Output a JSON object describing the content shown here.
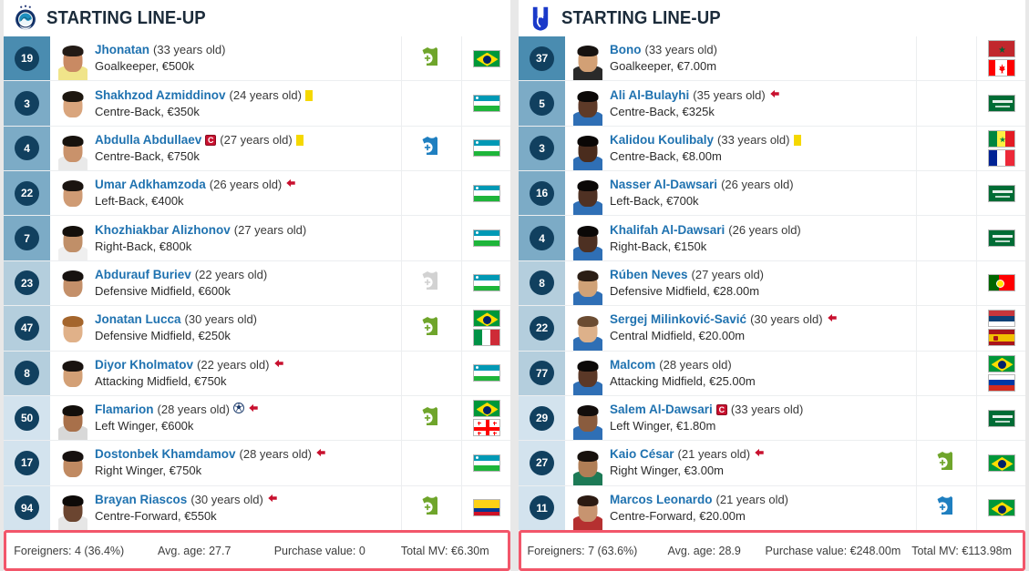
{
  "teams": [
    {
      "id": "left",
      "crest_icon": "pakhtakor-crest-icon",
      "title": "STARTING LINE-UP",
      "players": [
        {
          "number": "19",
          "name": "Jhonatan",
          "age": "(33 years old)",
          "detail": "Goalkeeper, €500k",
          "captain": false,
          "yellow": false,
          "goal": false,
          "arrow_out": false,
          "sub": "in",
          "group": "gk",
          "flags": [
            {
              "name": "brazil-flag",
              "colors": [
                "#009739",
                "#FEDD00",
                "#012169"
              ]
            }
          ],
          "skin": "#c98a63",
          "hair": "#231b16",
          "shirt": "#f0e48a"
        },
        {
          "number": "3",
          "name": "Shakhzod Azmiddinov",
          "age": "(24 years old)",
          "detail": "Centre-Back, €350k",
          "captain": false,
          "yellow": true,
          "goal": false,
          "arrow_out": false,
          "sub": "none",
          "group": "def",
          "flags": [
            {
              "name": "uzbekistan-flag",
              "colors": [
                "#0099B5",
                "#FFFFFF",
                "#1EB53A"
              ]
            }
          ],
          "skin": "#d9a57d",
          "hair": "#1d1710",
          "shirt": "#ffffff"
        },
        {
          "number": "4",
          "name": "Abdulla Abdullaev",
          "age": "(27 years old)",
          "detail": "Centre-Back, €750k",
          "captain": true,
          "yellow": true,
          "goal": false,
          "arrow_out": false,
          "sub": "out",
          "group": "def",
          "flags": [
            {
              "name": "uzbekistan-flag",
              "colors": [
                "#0099B5",
                "#FFFFFF",
                "#1EB53A"
              ]
            }
          ],
          "skin": "#c9926b",
          "hair": "#17120d",
          "shirt": "#e9e9e9"
        },
        {
          "number": "22",
          "name": "Umar Adkhamzoda",
          "age": "(26 years old)",
          "detail": "Left-Back, €400k",
          "captain": false,
          "yellow": false,
          "goal": false,
          "arrow_out": true,
          "sub": "none",
          "group": "def",
          "flags": [
            {
              "name": "uzbekistan-flag",
              "colors": [
                "#0099B5",
                "#FFFFFF",
                "#1EB53A"
              ]
            }
          ],
          "skin": "#cf9b74",
          "hair": "#1a1410",
          "shirt": "#ffffff"
        },
        {
          "number": "7",
          "name": "Khozhiakbar Alizhonov",
          "age": "(27 years old)",
          "detail": "Right-Back, €800k",
          "captain": false,
          "yellow": false,
          "goal": false,
          "arrow_out": false,
          "sub": "none",
          "group": "def",
          "flags": [
            {
              "name": "uzbekistan-flag",
              "colors": [
                "#0099B5",
                "#FFFFFF",
                "#1EB53A"
              ]
            }
          ],
          "skin": "#c08f68",
          "hair": "#130f0b",
          "shirt": "#efefef"
        },
        {
          "number": "23",
          "name": "Abdurauf Buriev",
          "age": "(22 years old)",
          "detail": "Defensive Midfield, €600k",
          "captain": false,
          "yellow": false,
          "goal": false,
          "arrow_out": false,
          "sub": "grey",
          "group": "mid",
          "flags": [
            {
              "name": "uzbekistan-flag",
              "colors": [
                "#0099B5",
                "#FFFFFF",
                "#1EB53A"
              ]
            }
          ],
          "skin": "#c4906a",
          "hair": "#171210",
          "shirt": "#ffffff"
        },
        {
          "number": "47",
          "name": "Jonatan Lucca",
          "age": "(30 years old)",
          "detail": "Defensive Midfield, €250k",
          "captain": false,
          "yellow": false,
          "goal": false,
          "arrow_out": false,
          "sub": "in",
          "group": "mid",
          "flags": [
            {
              "name": "brazil-flag",
              "colors": [
                "#009739",
                "#FEDD00",
                "#012169"
              ]
            },
            {
              "name": "italy-flag",
              "colors": [
                "#009246",
                "#FFFFFF",
                "#CE2B37"
              ]
            }
          ],
          "skin": "#e0b189",
          "hair": "#a4652c",
          "shirt": "#ffffff"
        },
        {
          "number": "8",
          "name": "Diyor Kholmatov",
          "age": "(22 years old)",
          "detail": "Attacking Midfield, €750k",
          "captain": false,
          "yellow": false,
          "goal": false,
          "arrow_out": true,
          "sub": "none",
          "group": "mid",
          "flags": [
            {
              "name": "uzbekistan-flag",
              "colors": [
                "#0099B5",
                "#FFFFFF",
                "#1EB53A"
              ]
            }
          ],
          "skin": "#d3a076",
          "hair": "#191310",
          "shirt": "#ffffff"
        },
        {
          "number": "50",
          "name": "Flamarion",
          "age": "(28 years old)",
          "detail": "Left Winger, €600k",
          "captain": false,
          "yellow": false,
          "goal": true,
          "arrow_out": true,
          "sub": "in",
          "group": "fwd",
          "flags": [
            {
              "name": "brazil-flag",
              "colors": [
                "#009739",
                "#FEDD00",
                "#012169"
              ]
            },
            {
              "name": "georgia-flag",
              "colors": [
                "#FFFFFF",
                "#FF0000",
                "#FFFFFF"
              ]
            }
          ],
          "skin": "#a8704a",
          "hair": "#120e0b",
          "shirt": "#d8d8d8"
        },
        {
          "number": "17",
          "name": "Dostonbek Khamdamov",
          "age": "(28 years old)",
          "detail": "Right Winger, €750k",
          "captain": false,
          "yellow": false,
          "goal": false,
          "arrow_out": true,
          "sub": "none",
          "group": "fwd",
          "flags": [
            {
              "name": "uzbekistan-flag",
              "colors": [
                "#0099B5",
                "#FFFFFF",
                "#1EB53A"
              ]
            }
          ],
          "skin": "#c08a62",
          "hair": "#161110",
          "shirt": "#ffffff"
        },
        {
          "number": "94",
          "name": "Brayan Riascos",
          "age": "(30 years old)",
          "detail": "Centre-Forward, €550k",
          "captain": false,
          "yellow": false,
          "goal": false,
          "arrow_out": true,
          "sub": "in",
          "group": "fwd",
          "flags": [
            {
              "name": "colombia-flag",
              "colors": [
                "#FCD116",
                "#003893",
                "#CE1126"
              ]
            }
          ],
          "skin": "#6b4530",
          "hair": "#0d0a08",
          "shirt": "#e6e6e6"
        }
      ],
      "footer": {
        "foreigners": "Foreigners: 4 (36.4%)",
        "avg_age": "Avg. age: 27.7",
        "purchase_value": "Purchase value: 0",
        "total_mv": "Total MV: €6.30m"
      }
    },
    {
      "id": "right",
      "crest_icon": "al-hilal-crest-icon",
      "title": "STARTING LINE-UP",
      "players": [
        {
          "number": "37",
          "name": "Bono",
          "age": "(33 years old)",
          "detail": "Goalkeeper, €7.00m",
          "captain": false,
          "yellow": false,
          "goal": false,
          "arrow_out": false,
          "sub": "none",
          "group": "gk",
          "flags": [
            {
              "name": "morocco-flag",
              "colors": [
                "#C1272D",
                "#006233",
                "#C1272D"
              ]
            },
            {
              "name": "canada-flag",
              "colors": [
                "#FF0000",
                "#FFFFFF",
                "#FF0000"
              ]
            }
          ],
          "skin": "#d2a075",
          "hair": "#161210",
          "shirt": "#2a2a2a"
        },
        {
          "number": "5",
          "name": "Ali Al-Bulayhi",
          "age": "(35 years old)",
          "detail": "Centre-Back, €325k",
          "captain": false,
          "yellow": false,
          "goal": false,
          "arrow_out": true,
          "sub": "none",
          "group": "def",
          "flags": [
            {
              "name": "saudi-arabia-flag",
              "colors": [
                "#006C35",
                "#FFFFFF",
                "#006C35"
              ]
            }
          ],
          "skin": "#5e3a28",
          "hair": "#0c0908",
          "shirt": "#2f6fb5"
        },
        {
          "number": "3",
          "name": "Kalidou Koulibaly",
          "age": "(33 years old)",
          "detail": "Centre-Back, €8.00m",
          "captain": false,
          "yellow": true,
          "goal": false,
          "arrow_out": false,
          "sub": "none",
          "group": "def",
          "flags": [
            {
              "name": "senegal-flag",
              "colors": [
                "#00853F",
                "#FDEF42",
                "#E31B23"
              ]
            },
            {
              "name": "france-flag",
              "colors": [
                "#002395",
                "#FFFFFF",
                "#ED2939"
              ]
            }
          ],
          "skin": "#4a2c1d",
          "hair": "#0a0706",
          "shirt": "#2f6fb5"
        },
        {
          "number": "16",
          "name": "Nasser Al-Dawsari",
          "age": "(26 years old)",
          "detail": "Left-Back, €700k",
          "captain": false,
          "yellow": false,
          "goal": false,
          "arrow_out": false,
          "sub": "none",
          "group": "def",
          "flags": [
            {
              "name": "saudi-arabia-flag",
              "colors": [
                "#006C35",
                "#FFFFFF",
                "#006C35"
              ]
            }
          ],
          "skin": "#4f3123",
          "hair": "#0b0807",
          "shirt": "#2f6fb5"
        },
        {
          "number": "4",
          "name": "Khalifah Al-Dawsari",
          "age": "(26 years old)",
          "detail": "Right-Back, €150k",
          "captain": false,
          "yellow": false,
          "goal": false,
          "arrow_out": false,
          "sub": "none",
          "group": "def",
          "flags": [
            {
              "name": "saudi-arabia-flag",
              "colors": [
                "#006C35",
                "#FFFFFF",
                "#006C35"
              ]
            }
          ],
          "skin": "#4d3022",
          "hair": "#0b0807",
          "shirt": "#2f6fb5"
        },
        {
          "number": "8",
          "name": "Rúben Neves",
          "age": "(27 years old)",
          "detail": "Defensive Midfield, €28.00m",
          "captain": false,
          "yellow": false,
          "goal": false,
          "arrow_out": false,
          "sub": "none",
          "group": "mid",
          "flags": [
            {
              "name": "portugal-flag",
              "colors": [
                "#006600",
                "#FF0000",
                "#FFE900"
              ]
            }
          ],
          "skin": "#d0a277",
          "hair": "#2a1d14",
          "shirt": "#2f6fb5"
        },
        {
          "number": "22",
          "name": "Sergej Milinković-Savić",
          "age": "(30 years old)",
          "detail": "Central Midfield, €20.00m",
          "captain": false,
          "yellow": false,
          "goal": false,
          "arrow_out": true,
          "sub": "none",
          "group": "mid",
          "flags": [
            {
              "name": "serbia-flag",
              "colors": [
                "#C6363C",
                "#0C4076",
                "#FFFFFF"
              ]
            },
            {
              "name": "spain-flag",
              "colors": [
                "#AA151B",
                "#F1BF00",
                "#AA151B"
              ]
            }
          ],
          "skin": "#ddb18a",
          "hair": "#6b4c32",
          "shirt": "#2f6fb5"
        },
        {
          "number": "77",
          "name": "Malcom",
          "age": "(28 years old)",
          "detail": "Attacking Midfield, €25.00m",
          "captain": false,
          "yellow": false,
          "goal": false,
          "arrow_out": false,
          "sub": "none",
          "group": "mid",
          "flags": [
            {
              "name": "brazil-flag",
              "colors": [
                "#009739",
                "#FEDD00",
                "#012169"
              ]
            },
            {
              "name": "russia-flag",
              "colors": [
                "#FFFFFF",
                "#0039A6",
                "#D52B1E"
              ]
            }
          ],
          "skin": "#5b3827",
          "hair": "#0c0908",
          "shirt": "#2f6fb5"
        },
        {
          "number": "29",
          "name": "Salem Al-Dawsari",
          "age": "(33 years old)",
          "detail": "Left Winger, €1.80m",
          "captain": true,
          "yellow": false,
          "goal": false,
          "arrow_out": false,
          "sub": "none",
          "group": "fwd",
          "flags": [
            {
              "name": "saudi-arabia-flag",
              "colors": [
                "#006C35",
                "#FFFFFF",
                "#006C35"
              ]
            }
          ],
          "skin": "#8a5c3e",
          "hair": "#120d0b",
          "shirt": "#2f6fb5"
        },
        {
          "number": "27",
          "name": "Kaio César",
          "age": "(21 years old)",
          "detail": "Right Winger, €3.00m",
          "captain": false,
          "yellow": false,
          "goal": false,
          "arrow_out": true,
          "sub": "in",
          "group": "fwd",
          "flags": [
            {
              "name": "brazil-flag",
              "colors": [
                "#009739",
                "#FEDD00",
                "#012169"
              ]
            }
          ],
          "skin": "#b07e56",
          "hair": "#17110d",
          "shirt": "#1d7a56"
        },
        {
          "number": "11",
          "name": "Marcos Leonardo",
          "age": "(21 years old)",
          "detail": "Centre-Forward, €20.00m",
          "captain": false,
          "yellow": false,
          "goal": false,
          "arrow_out": false,
          "sub": "out",
          "group": "fwd",
          "flags": [
            {
              "name": "brazil-flag",
              "colors": [
                "#009739",
                "#FEDD00",
                "#012169"
              ]
            }
          ],
          "skin": "#c79470",
          "hair": "#2b1a12",
          "shirt": "#b53030"
        }
      ],
      "footer": {
        "foreigners": "Foreigners: 7 (63.6%)",
        "avg_age": "Avg. age: 28.9",
        "purchase_value": "Purchase value: €248.00m",
        "total_mv": "Total MV: €113.98m"
      }
    }
  ],
  "colors": {
    "group_gk": "#4a8cb0",
    "group_def": "#7cabc6",
    "group_mid": "#b4cedd",
    "group_fwd": "#d3e3ee",
    "badge": "#11405f",
    "name_link": "#1f72b0",
    "sub_in": "#6fa52b",
    "sub_out": "#1f7fc0",
    "sub_grey": "#d2d2d2",
    "highlight_border": "#f2566a"
  }
}
